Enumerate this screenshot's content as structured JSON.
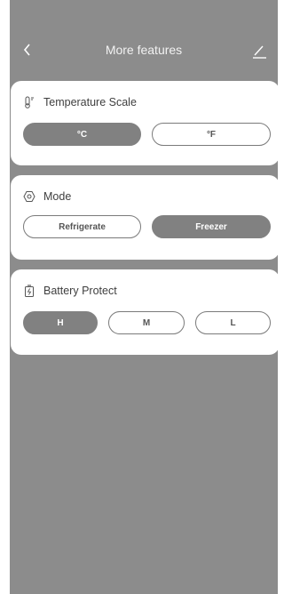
{
  "header": {
    "title": "More features"
  },
  "temperature": {
    "label": "Temperature Scale",
    "options": [
      "°C",
      "°F"
    ],
    "selected": "°C"
  },
  "mode": {
    "label": "Mode",
    "options": [
      "Refrigerate",
      "Freezer"
    ],
    "selected": "Freezer"
  },
  "battery": {
    "label": "Battery Protect",
    "options": [
      "H",
      "M",
      "L"
    ],
    "selected": "H"
  },
  "colors": {
    "background": "#8c8c8c",
    "card": "#ffffff",
    "active": "#818181"
  }
}
